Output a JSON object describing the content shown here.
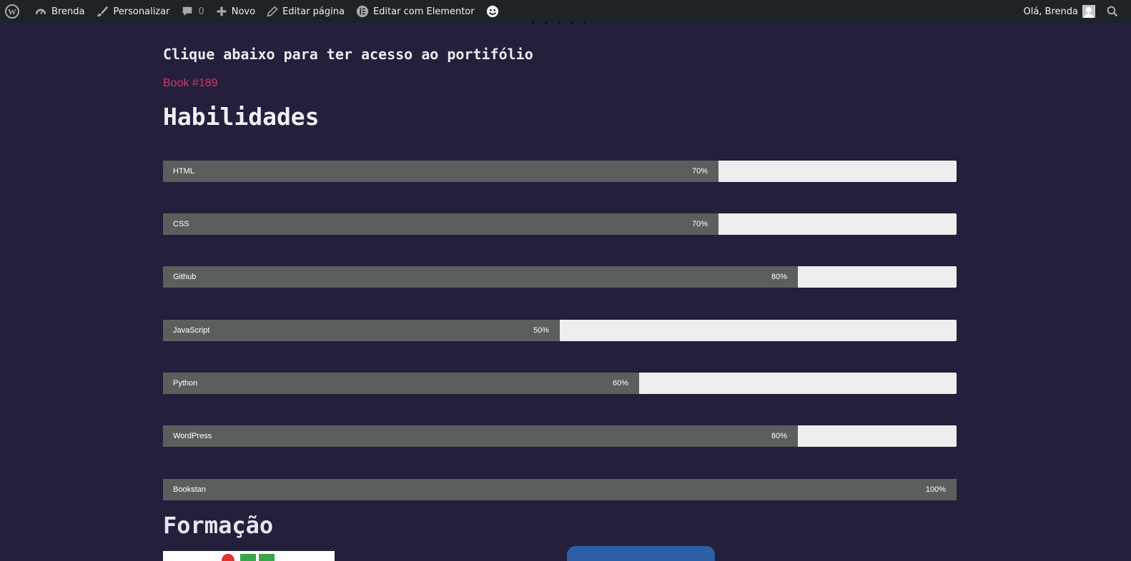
{
  "admin_bar": {
    "site_name": "Brenda",
    "customize": "Personalizar",
    "comments_count": "0",
    "new": "Novo",
    "edit_page": "Editar página",
    "edit_elementor": "Editar com Elementor",
    "greeting": "Olá, Brenda"
  },
  "content": {
    "intro": "Clique abaixo para ter acesso ao portifólio",
    "book_link": "Book #189",
    "skills_heading": "Habilidades",
    "education_heading": "Formação"
  },
  "skills": [
    {
      "name": "HTML",
      "percent": 70,
      "label": "70%"
    },
    {
      "name": "CSS",
      "percent": 70,
      "label": "70%"
    },
    {
      "name": "Github",
      "percent": 80,
      "label": "80%"
    },
    {
      "name": "JavaScript",
      "percent": 50,
      "label": "50%"
    },
    {
      "name": "Python",
      "percent": 60,
      "label": "60%"
    },
    {
      "name": "WordPress",
      "percent": 80,
      "label": "80%"
    },
    {
      "name": "Bookstan",
      "percent": 100,
      "label": "100%"
    }
  ],
  "colors": {
    "page_bg": "#241f3b",
    "admin_bar_bg": "#1d2327",
    "bar_fill": "#5a5f5d",
    "bar_track": "#eeeeee",
    "link": "#d1386b"
  },
  "icons": [
    "wordpress-icon",
    "dashboard-icon",
    "brush-icon",
    "comment-icon",
    "plus-icon",
    "pencil-icon",
    "elementor-icon",
    "smiley-icon",
    "avatar-icon",
    "search-icon"
  ]
}
